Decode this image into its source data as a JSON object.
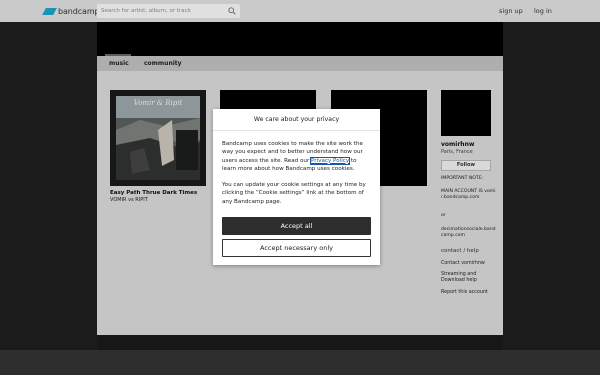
{
  "header": {
    "logo_text": "bandcamp",
    "search_placeholder": "Search for artist, album, or track",
    "signup_label": "sign up",
    "login_label": "log in"
  },
  "nav": {
    "tabs": [
      {
        "label": "music"
      },
      {
        "label": "community"
      }
    ]
  },
  "albums": [
    {
      "title": "Easy Path Thrue Dark Times",
      "artist": "VOMIR vs RIPIT",
      "cover_text": "Vomir & Ripit"
    }
  ],
  "sidebar": {
    "band_name": "vomirhnw",
    "location": "Paris, France",
    "follow_label": "Follow",
    "bio": {
      "line1": "IMPORTANT NOTE:",
      "line2": "MAIN ACCOUNT IS vomir.bandcamp.com",
      "line3": "or",
      "line4": "decimationsociale.bandcamp.com"
    },
    "contact_heading": "contact / help",
    "links": {
      "contact": "Contact vomirhnw",
      "streaming": "Streaming and Download help",
      "report": "Report this account"
    }
  },
  "cookie_dialog": {
    "title": "We care about your privacy",
    "p1_before": "Bandcamp uses cookies to make the site work the way you expect and to better understand how our users access the site. Read our ",
    "policy_link": "Privacy Policy",
    "p1_after": " to learn more about how Bandcamp uses cookies.",
    "p2": "You can update your cookie settings at any time by clicking the “Cookie settings” link at the bottom of any Bandcamp page.",
    "accept_all_label": "Accept all",
    "accept_necessary_label": "Accept necessary only"
  },
  "colors": {
    "brand": "#1da0c3",
    "topbar": "#dcdcdc",
    "content_bg": "#d6d6d6",
    "nav_bg": "#bdbdbd",
    "button_dark": "#2d2d2d"
  }
}
